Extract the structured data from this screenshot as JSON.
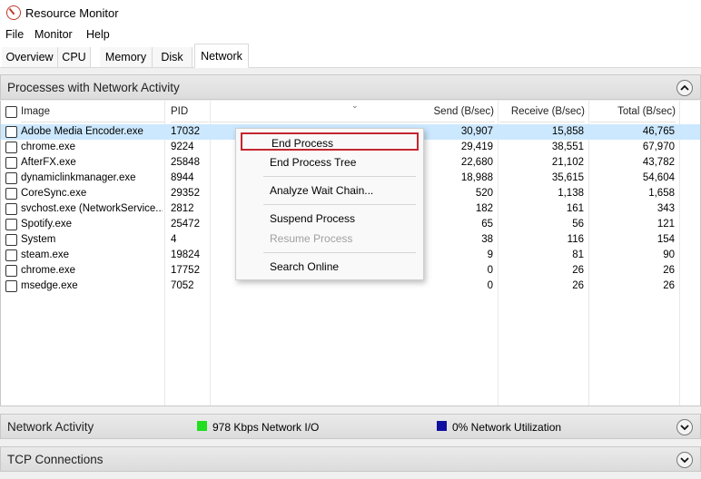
{
  "window": {
    "title": "Resource Monitor"
  },
  "menu": [
    "File",
    "Monitor",
    "Help"
  ],
  "tabs": [
    "Overview",
    "CPU",
    "Memory",
    "Disk",
    "Network"
  ],
  "processes_section": {
    "title": "Processes with Network Activity",
    "columns": [
      "Image",
      "PID",
      "Send (B/sec)",
      "Receive (B/sec)",
      "Total (B/sec)"
    ],
    "rows": [
      {
        "image": "Adobe Media Encoder.exe",
        "pid": "17032",
        "send": "30,907",
        "receive": "15,858",
        "total": "46,765"
      },
      {
        "image": "chrome.exe",
        "pid": "9224",
        "send": "29,419",
        "receive": "38,551",
        "total": "67,970"
      },
      {
        "image": "AfterFX.exe",
        "pid": "25848",
        "send": "22,680",
        "receive": "21,102",
        "total": "43,782"
      },
      {
        "image": "dynamiclinkmanager.exe",
        "pid": "8944",
        "send": "18,988",
        "receive": "35,615",
        "total": "54,604"
      },
      {
        "image": "CoreSync.exe",
        "pid": "29352",
        "send": "520",
        "receive": "1,138",
        "total": "1,658"
      },
      {
        "image": "svchost.exe (NetworkService...",
        "pid": "2812",
        "send": "182",
        "receive": "161",
        "total": "343"
      },
      {
        "image": "Spotify.exe",
        "pid": "25472",
        "send": "65",
        "receive": "56",
        "total": "121"
      },
      {
        "image": "System",
        "pid": "4",
        "send": "38",
        "receive": "116",
        "total": "154"
      },
      {
        "image": "steam.exe",
        "pid": "19824",
        "send": "9",
        "receive": "81",
        "total": "90"
      },
      {
        "image": "chrome.exe",
        "pid": "17752",
        "send": "0",
        "receive": "26",
        "total": "26"
      },
      {
        "image": "msedge.exe",
        "pid": "7052",
        "send": "0",
        "receive": "26",
        "total": "26"
      }
    ],
    "selected_row": 0
  },
  "context_menu": {
    "items": [
      "End Process",
      "End Process Tree",
      "Analyze Wait Chain...",
      "Suspend Process",
      "Resume Process",
      "Search Online"
    ],
    "highlighted": "End Process",
    "disabled": "Resume Process",
    "highlight_color": "#c4262e"
  },
  "network_activity": {
    "title": "Network Activity",
    "io_text": "978 Kbps Network I/O",
    "io_color": "#22dd22",
    "util_text": "0% Network Utilization",
    "util_color": "#1010a0"
  },
  "tcp_section": {
    "title": "TCP Connections"
  },
  "icons": {
    "app": "resource-monitor-icon",
    "collapse": "chevron-up-icon",
    "expand": "chevron-down-icon",
    "sort": "sort-caret-icon"
  }
}
